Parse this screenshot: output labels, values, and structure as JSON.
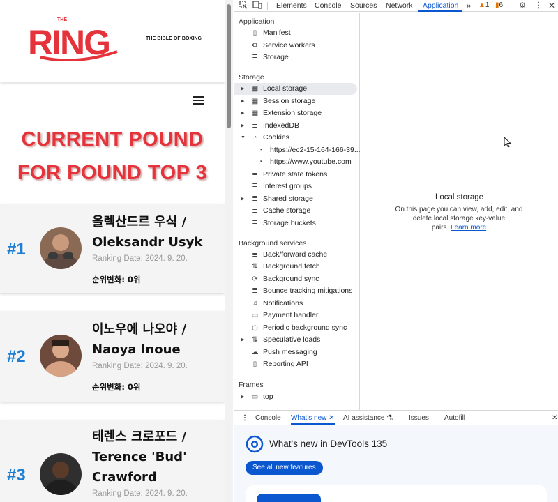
{
  "site": {
    "logo_small_text": "THE",
    "logo_text": "RING",
    "tagline": "THE BIBLE OF BOXING",
    "hero_line1": "CURRENT POUND",
    "hero_line2": "FOR POUND TOP 3",
    "fighters": [
      {
        "rank": "#1",
        "name_line1": "올렉산드르 우식 /",
        "name_line2": "Oleksandr Usyk",
        "name_line3": "",
        "date": "Ranking Date: 2024. 9. 20.",
        "change": "순위변화: 0위"
      },
      {
        "rank": "#2",
        "name_line1": "이노우에 나오야 /",
        "name_line2": "Naoya Inoue",
        "name_line3": "",
        "date": "Ranking Date: 2024. 9. 20.",
        "change": "순위변화: 0위"
      },
      {
        "rank": "#3",
        "name_line1": "테렌스 크로포드 /",
        "name_line2": "Terence 'Bud'",
        "name_line3": "Crawford",
        "date": "Ranking Date: 2024. 9. 20.",
        "change": ""
      }
    ],
    "colors": {
      "brand_red": "#e5333b",
      "rank_blue": "#1e7fd2"
    }
  },
  "devtools": {
    "tabs": [
      "Elements",
      "Console",
      "Sources",
      "Network",
      "Application"
    ],
    "active_tab": "Application",
    "more_tabs_icon": "chevron-double-right-icon",
    "warning_count": "1",
    "issue_count": "6",
    "sidebar": {
      "application_header": "Application",
      "application_items": [
        "Manifest",
        "Service workers",
        "Storage"
      ],
      "storage_header": "Storage",
      "storage_items": [
        "Local storage",
        "Session storage",
        "Extension storage",
        "IndexedDB",
        "Cookies",
        "https://ec2-15-164-166-39...",
        "https://www.youtube.com",
        "Private state tokens",
        "Interest groups",
        "Shared storage",
        "Cache storage",
        "Storage buckets"
      ],
      "background_header": "Background services",
      "background_items": [
        "Back/forward cache",
        "Background fetch",
        "Background sync",
        "Bounce tracking mitigations",
        "Notifications",
        "Payment handler",
        "Periodic background sync",
        "Speculative loads",
        "Push messaging",
        "Reporting API"
      ],
      "frames_header": "Frames",
      "frames_items": [
        "top"
      ]
    },
    "main": {
      "title": "Local storage",
      "description_1": "On this page you can view, add, edit, and",
      "description_2": "delete local storage key-value",
      "description_3": "pairs.",
      "learn_more": "Learn more"
    },
    "drawer": {
      "tabs": [
        "Console",
        "What's new",
        "AI assistance",
        "Issues",
        "Autofill"
      ],
      "active_tab": "What's new",
      "title": "What's new in DevTools 135",
      "button": "See all new features"
    },
    "colors": {
      "accent": "#0b57d0",
      "warning": "#e37400"
    }
  }
}
